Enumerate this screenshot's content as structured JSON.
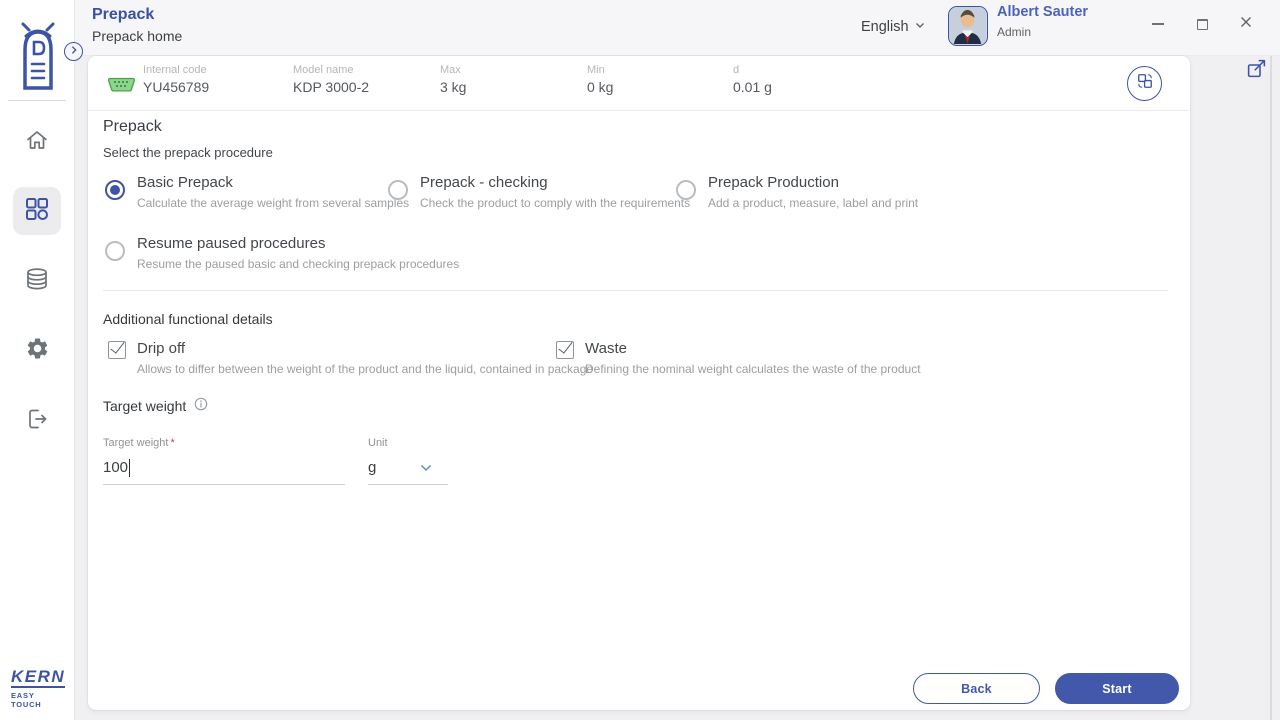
{
  "header": {
    "title": "Prepack",
    "subtitle": "Prepack home",
    "language": "English",
    "user": {
      "name": "Albert Sauter",
      "role": "Admin"
    }
  },
  "device_bar": {
    "fields": [
      {
        "label": "Internal code",
        "value": "YU456789"
      },
      {
        "label": "Model name",
        "value": "KDP 3000-2"
      },
      {
        "label": "Max",
        "value": "3 kg"
      },
      {
        "label": "Min",
        "value": "0 kg"
      },
      {
        "label": "d",
        "value": "0.01 g"
      }
    ]
  },
  "main": {
    "section_title": "Prepack",
    "section_subtitle": "Select the prepack procedure",
    "procedures": [
      {
        "label": "Basic Prepack",
        "description": "Calculate the average weight from several samples",
        "selected": true
      },
      {
        "label": "Prepack - checking",
        "description": "Check the product to comply with the requirements",
        "selected": false
      },
      {
        "label": "Prepack Production",
        "description": "Add a product, measure, label and print",
        "selected": false
      },
      {
        "label": "Resume paused procedures",
        "description": "Resume the paused basic and checking prepack procedures",
        "selected": false
      }
    ],
    "details_title": "Additional functional details",
    "options": [
      {
        "label": "Drip off",
        "description": "Allows to differ between the weight of the product and the liquid, contained in package",
        "checked": true
      },
      {
        "label": "Waste",
        "description": "Defining the nominal weight calculates the waste of the product",
        "checked": true
      }
    ],
    "target_weight_title": "Target weight",
    "form": {
      "target_weight_label": "Target weight",
      "required_mark": "*",
      "target_weight_value": "100",
      "unit_label": "Unit",
      "unit_value": "g"
    },
    "buttons": {
      "back": "Back",
      "start": "Start"
    }
  },
  "footer": {
    "brand": "KERN",
    "brand_sub": "EASY TOUCH"
  },
  "colors": {
    "accent": "#3d53a6",
    "button": "#4258ab",
    "port_green": "#6abf69"
  }
}
